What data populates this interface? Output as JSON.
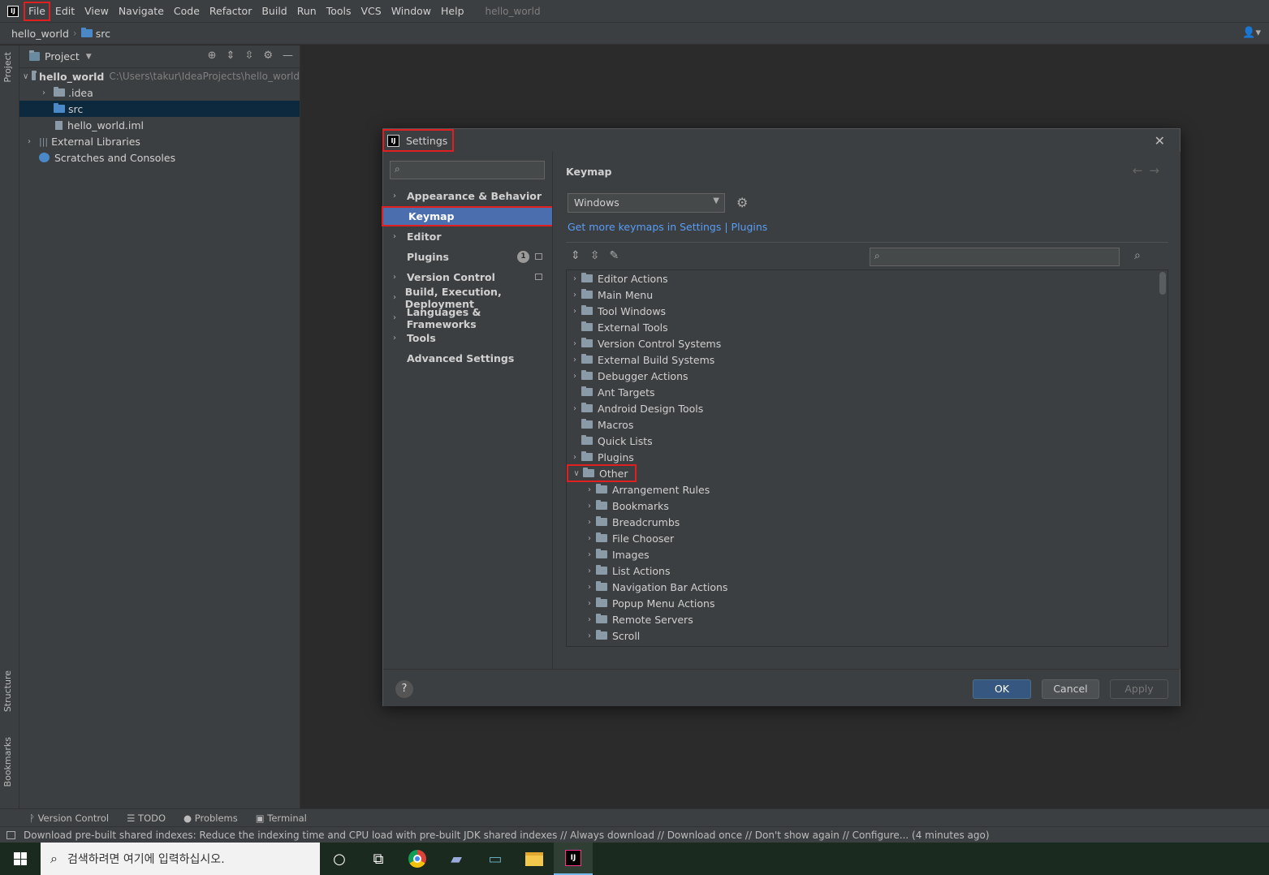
{
  "menubar": {
    "items": [
      "File",
      "Edit",
      "View",
      "Navigate",
      "Code",
      "Refactor",
      "Build",
      "Run",
      "Tools",
      "VCS",
      "Window",
      "Help"
    ],
    "project_name": "hello_world"
  },
  "navbar": {
    "project": "hello_world",
    "folder": "src"
  },
  "stripe": {
    "project": "Project",
    "structure": "Structure",
    "bookmarks": "Bookmarks"
  },
  "project_panel": {
    "title": "Project",
    "root": {
      "name": "hello_world",
      "path": "C:\\Users\\takur\\IdeaProjects\\hello_world"
    },
    "children": [
      ".idea",
      "src",
      "hello_world.iml"
    ],
    "external_libraries": "External Libraries",
    "scratches": "Scratches and Consoles"
  },
  "settings": {
    "title": "Settings",
    "nav": [
      {
        "label": "Appearance & Behavior",
        "expandable": true
      },
      {
        "label": "Keymap",
        "expandable": false,
        "selected": true
      },
      {
        "label": "Editor",
        "expandable": true
      },
      {
        "label": "Plugins",
        "expandable": false,
        "badge": "1"
      },
      {
        "label": "Version Control",
        "expandable": true
      },
      {
        "label": "Build, Execution, Deployment",
        "expandable": true
      },
      {
        "label": "Languages & Frameworks",
        "expandable": true
      },
      {
        "label": "Tools",
        "expandable": true
      },
      {
        "label": "Advanced Settings",
        "expandable": false
      }
    ],
    "keymap": {
      "title": "Keymap",
      "selected": "Windows",
      "link": "Get more keymaps in Settings | Plugins",
      "tree": [
        {
          "label": "Editor Actions",
          "level": 0,
          "expandable": true
        },
        {
          "label": "Main Menu",
          "level": 0,
          "expandable": true
        },
        {
          "label": "Tool Windows",
          "level": 0,
          "expandable": true
        },
        {
          "label": "External Tools",
          "level": 0,
          "expandable": false
        },
        {
          "label": "Version Control Systems",
          "level": 0,
          "expandable": true
        },
        {
          "label": "External Build Systems",
          "level": 0,
          "expandable": true
        },
        {
          "label": "Debugger Actions",
          "level": 0,
          "expandable": true
        },
        {
          "label": "Ant Targets",
          "level": 0,
          "expandable": false
        },
        {
          "label": "Android Design Tools",
          "level": 0,
          "expandable": true
        },
        {
          "label": "Macros",
          "level": 0,
          "expandable": false
        },
        {
          "label": "Quick Lists",
          "level": 0,
          "expandable": false
        },
        {
          "label": "Plugins",
          "level": 0,
          "expandable": true
        },
        {
          "label": "Other",
          "level": 0,
          "expandable": true,
          "expanded": true
        },
        {
          "label": "Arrangement Rules",
          "level": 1,
          "expandable": true
        },
        {
          "label": "Bookmarks",
          "level": 1,
          "expandable": true
        },
        {
          "label": "Breadcrumbs",
          "level": 1,
          "expandable": true
        },
        {
          "label": "File Chooser",
          "level": 1,
          "expandable": true
        },
        {
          "label": "Images",
          "level": 1,
          "expandable": true
        },
        {
          "label": "List Actions",
          "level": 1,
          "expandable": true
        },
        {
          "label": "Navigation Bar Actions",
          "level": 1,
          "expandable": true
        },
        {
          "label": "Popup Menu Actions",
          "level": 1,
          "expandable": true
        },
        {
          "label": "Remote Servers",
          "level": 1,
          "expandable": true
        },
        {
          "label": "Scroll",
          "level": 1,
          "expandable": true
        }
      ]
    },
    "buttons": {
      "ok": "OK",
      "cancel": "Cancel",
      "apply": "Apply",
      "help": "?"
    }
  },
  "toolwindows": [
    "Version Control",
    "TODO",
    "Problems",
    "Terminal"
  ],
  "status": "Download pre-built shared indexes: Reduce the indexing time and CPU load with pre-built JDK shared indexes // Always download // Download once // Don't show again // Configure... (4 minutes ago)",
  "taskbar": {
    "search_placeholder": "검색하려면 여기에 입력하십시오."
  },
  "colors": {
    "highlight": "#e02020",
    "selection": "#4b6eaf",
    "link": "#589df6",
    "ok_button": "#365880"
  }
}
